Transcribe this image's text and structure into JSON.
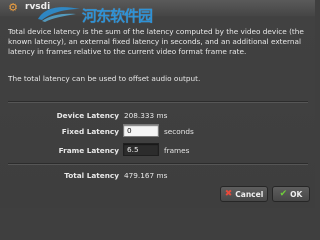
{
  "window": {
    "title": "rvsdi",
    "app_icon": "gear-icon",
    "watermark_text": "河东软件园"
  },
  "description": {
    "paragraph_1": "Total device latency is the sum of the latency computed by the video device (the known latency), an external fixed latency in seconds, and an additional external latency in frames relative to the current video format frame rate.",
    "paragraph_2": "The total latency can be used to offset audio output."
  },
  "latency": {
    "device_label": "Device Latency",
    "device_value": "208.333 ms",
    "fixed_label": "Fixed Latency",
    "fixed_value": "0",
    "fixed_unit": "seconds",
    "frame_label": "Frame Latency",
    "frame_value": "6.5",
    "frame_unit": "frames",
    "total_label": "Total Latency",
    "total_value": "479.167 ms"
  },
  "buttons": {
    "cancel_label": "Cancel",
    "ok_label": "OK",
    "cancel_icon": "cancel-icon",
    "ok_icon": "check-icon"
  },
  "colors": {
    "background": "#3e3e3e",
    "text": "#e8e8e8",
    "watermark": "#2896e1",
    "cancel_icon": "#e84a3a",
    "ok_icon": "#6fce3a"
  }
}
